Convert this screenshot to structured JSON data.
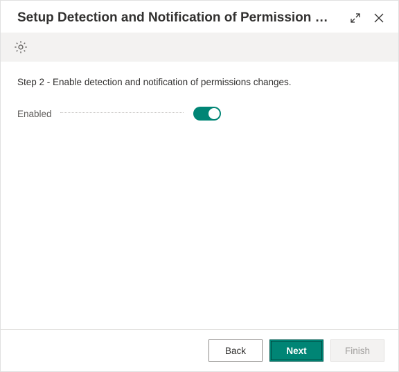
{
  "header": {
    "title": "Setup Detection and Notification of Permission …"
  },
  "content": {
    "step_text": "Step 2 - Enable detection and notification of permissions changes.",
    "field_label": "Enabled",
    "toggle_on": true
  },
  "footer": {
    "back_label": "Back",
    "next_label": "Next",
    "finish_label": "Finish"
  }
}
